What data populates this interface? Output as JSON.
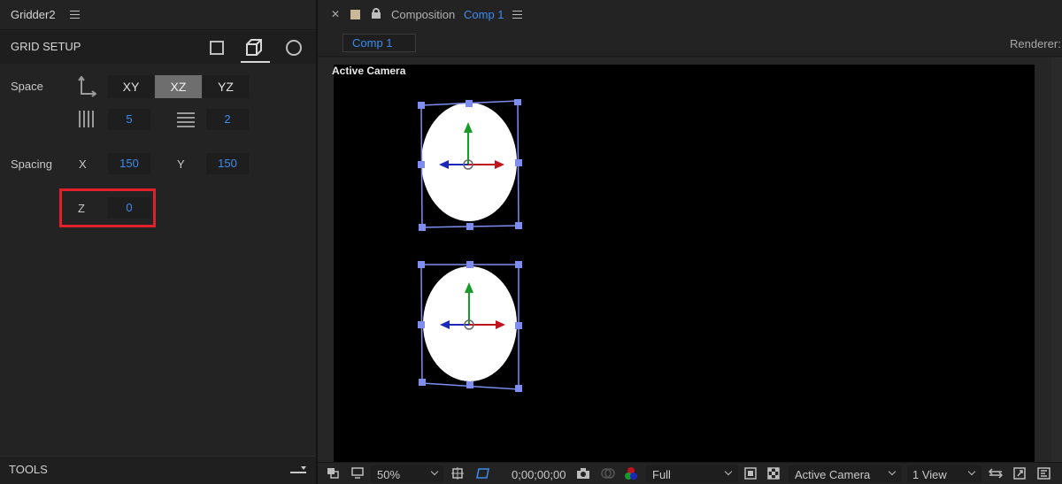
{
  "left_panel": {
    "tab_title": "Gridder2",
    "section_title": "GRID SETUP",
    "modes": [
      "square-mode",
      "cube-mode",
      "circle-mode"
    ],
    "space": {
      "label": "Space",
      "options": [
        "XY",
        "XZ",
        "YZ"
      ],
      "selected": "XZ",
      "columns_value": "5",
      "rows_value": "2"
    },
    "spacing": {
      "label": "Spacing",
      "x_label": "X",
      "x_value": "150",
      "y_label": "Y",
      "y_value": "150",
      "z_label": "Z",
      "z_value": "0"
    },
    "tools_label": "TOOLS"
  },
  "composition_panel": {
    "tab_prefix": "Composition",
    "comp_name": "Comp 1",
    "chip_label": "Comp 1",
    "renderer_label": "Renderer:",
    "viewer_label": "Active Camera",
    "toolbar": {
      "zoom": "50%",
      "timecode": "0;00;00;00",
      "resolution": "Full",
      "camera": "Active Camera",
      "views": "1 View"
    }
  },
  "colors": {
    "accent_blue": "#3c8cf0",
    "highlight_red": "#e3202a",
    "selection_handle": "#7e8ef0",
    "axis_green": "#1a9a2a",
    "axis_red": "#c0141c",
    "axis_blue": "#1c28b8"
  }
}
